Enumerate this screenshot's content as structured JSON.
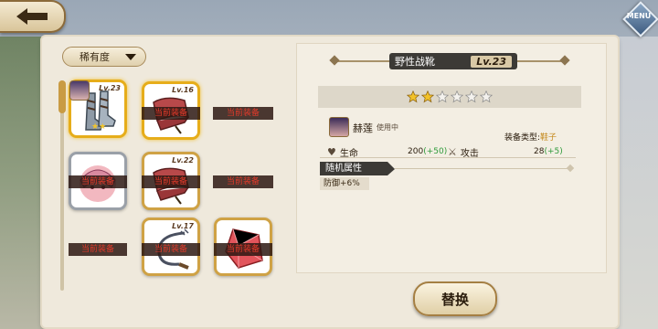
{
  "nav": {
    "menu_label": "MENU"
  },
  "sort": {
    "label": "稀有度"
  },
  "inventory": {
    "equipped_label": "当前装备",
    "items": [
      {
        "type": "boots",
        "level": "Lv.23",
        "stars": 2,
        "selected": true,
        "equipped": false
      },
      {
        "type": "scroll",
        "level": "Lv.16",
        "selected": true,
        "equipped": true
      },
      {
        "type": "empty",
        "equipped": true
      },
      {
        "type": "character",
        "equipped": true
      },
      {
        "type": "scroll",
        "level": "Lv.22",
        "equipped": true
      },
      {
        "type": "empty",
        "equipped": true
      },
      {
        "type": "empty",
        "equipped": true
      },
      {
        "type": "whip",
        "level": "Lv.17",
        "equipped": true
      },
      {
        "type": "gem",
        "equipped": true
      }
    ]
  },
  "detail": {
    "item_name": "野性战靴",
    "item_level": "Lv.23",
    "stars_filled": 2,
    "stars_total": 6,
    "owner_name": "赫莲",
    "owner_status": "使用中",
    "type_label": "装备类型:",
    "type_value": "鞋子",
    "stats": {
      "hp_label": "生命",
      "hp_value": "200",
      "hp_bonus": "(+50)",
      "atk_label": "攻击",
      "atk_value": "28",
      "atk_bonus": "(+5)"
    },
    "random_header": "随机属性",
    "random_value": "防御+6%"
  },
  "actions": {
    "replace_label": "替换"
  },
  "colors": {
    "accent_gold": "#cfa245",
    "equipped_red": "#e03a2a",
    "bonus_green": "#2e9a3a",
    "dark_bar": "#3c3a36"
  }
}
